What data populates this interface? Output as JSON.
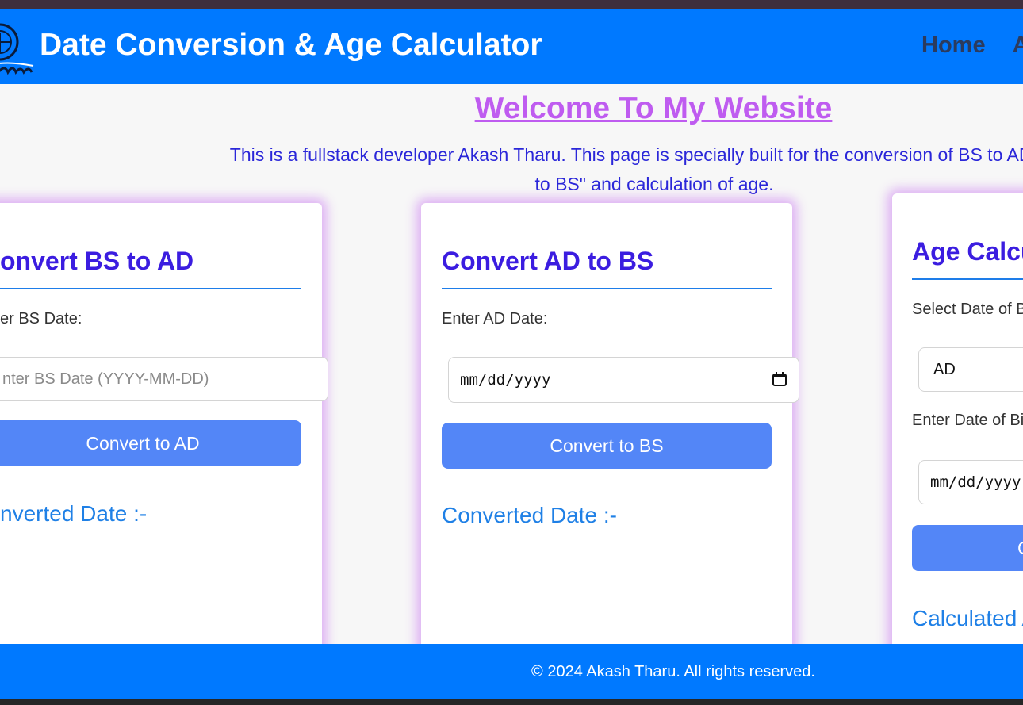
{
  "header": {
    "title": "Date Conversion & Age Calculator",
    "nav": [
      "Home",
      "A"
    ]
  },
  "welcome": {
    "heading": "Welcome To My Website",
    "intro": "This is a fullstack developer Akash Tharu. This page is specially built for the conversion of BS to AD & AD to BS\" and calculation of age."
  },
  "bs_to_ad": {
    "title": "onvert BS to AD",
    "label": "er BS Date:",
    "placeholder": "nter BS Date (YYYY-MM-DD)",
    "button": "Convert to AD",
    "result_label": "nverted Date :-"
  },
  "ad_to_bs": {
    "title": "Convert AD to BS",
    "label": "Enter AD Date:",
    "date_value": "mm/dd/yyyy",
    "button": "Convert to BS",
    "result_label": "Converted Date :-"
  },
  "age_calc": {
    "title": "Age Calcu",
    "select_label": "Select Date of B",
    "select_value": "AD",
    "dob_label": "Enter Date of Bi",
    "date_value": "mm/dd/yyyy",
    "button": "C",
    "result_label": "Calculated A"
  },
  "footer": {
    "copyright": "© 2024 Akash Tharu. All rights reserved."
  },
  "colors": {
    "header_bg": "#0079ff",
    "welcome": "#bf5cf0",
    "intro": "#2b27d9",
    "card_title": "#3b1de0",
    "button": "#5386f7",
    "result": "#1f80e6"
  }
}
